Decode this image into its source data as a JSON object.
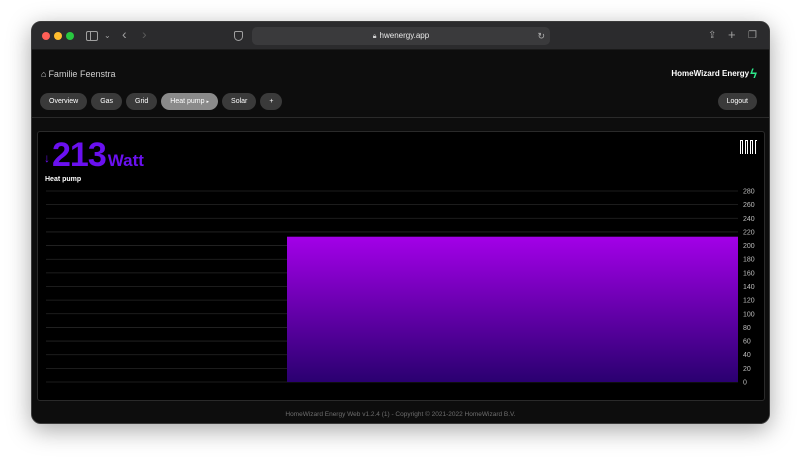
{
  "browser": {
    "url": "hwenergy.app",
    "icons": [
      "close-dot",
      "minimize-dot",
      "zoom-dot",
      "sidebar-icon",
      "chevron-down-icon",
      "back-icon",
      "forward-icon",
      "shield-icon",
      "lock-icon",
      "reload-icon",
      "share-icon",
      "plus-icon",
      "tabs-icon"
    ]
  },
  "header": {
    "household": "Familie Feenstra",
    "logo_text": "HomeWizard Energy",
    "tabs": [
      {
        "label": "Overview"
      },
      {
        "label": "Gas"
      },
      {
        "label": "Grid"
      },
      {
        "label": "Heat pump",
        "active": true
      },
      {
        "label": "Solar"
      },
      {
        "label": "+"
      }
    ],
    "logout_label": "Logout"
  },
  "reading": {
    "value": "213",
    "unit": "Watt",
    "device": "Heat pump",
    "arrow": "↓"
  },
  "chart_data": {
    "type": "bar",
    "ylim": [
      0,
      280
    ],
    "yticks": [
      "280",
      "260",
      "240",
      "220",
      "200",
      "180",
      "160",
      "140",
      "120",
      "100",
      "80",
      "60",
      "40",
      "20",
      "0"
    ],
    "values": [
      0,
      213
    ],
    "grid": true,
    "colors": {
      "top": "#a300e8",
      "bottom": "#2a0070"
    }
  },
  "footer": {
    "text": "HomeWizard Energy Web v1.2.4 (1) - Copyright © 2021-2022 HomeWizard B.V."
  },
  "colors": {
    "accent": "#6a10f0",
    "background": "#000000",
    "tab": "#3a3a3a",
    "tab_active": "#8a8a8a"
  }
}
